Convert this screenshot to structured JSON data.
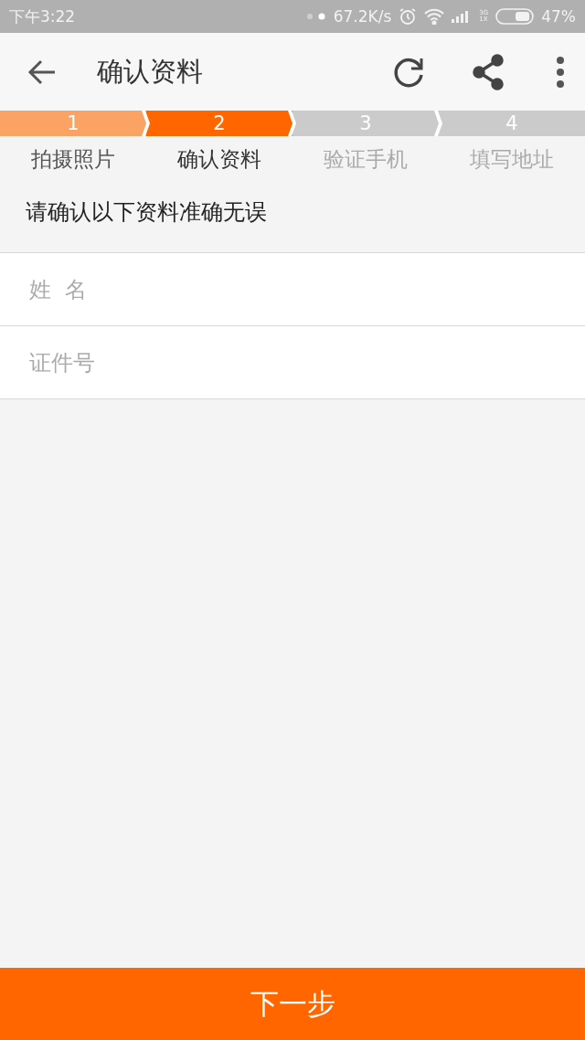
{
  "status_bar": {
    "time": "下午3:22",
    "speed": "67.2K/s",
    "network": [
      "3G",
      "1X"
    ],
    "battery": "47%"
  },
  "toolbar": {
    "title": "确认资料"
  },
  "steps": [
    {
      "number": "1",
      "label": "拍摄照片",
      "completed": true,
      "selected": false
    },
    {
      "number": "2",
      "label": "确认资料",
      "completed": false,
      "selected": true
    },
    {
      "number": "3",
      "label": "验证手机",
      "completed": false,
      "selected": false
    },
    {
      "number": "4",
      "label": "填写地址",
      "completed": false,
      "selected": false
    }
  ],
  "prompt": "请确认以下资料准确无误",
  "fields": [
    {
      "placeholder": "姓  名"
    },
    {
      "placeholder": "证件号"
    }
  ],
  "next_button": "下一步"
}
